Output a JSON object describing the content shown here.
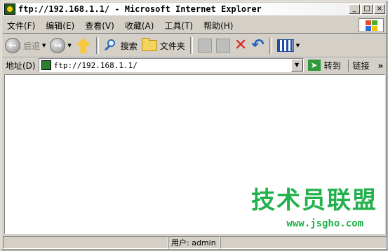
{
  "window": {
    "title": "ftp://192.168.1.1/ - Microsoft Internet Explorer",
    "buttons": {
      "minimize": "_",
      "maximize": "□",
      "close": "×"
    }
  },
  "menu": {
    "items": [
      {
        "label": "文件(F)"
      },
      {
        "label": "编辑(E)"
      },
      {
        "label": "查看(V)"
      },
      {
        "label": "收藏(A)"
      },
      {
        "label": "工具(T)"
      },
      {
        "label": "帮助(H)"
      }
    ]
  },
  "toolbar": {
    "back_label": "后退",
    "search_label": "搜索",
    "folders_label": "文件夹",
    "icons": {
      "back": "back-arrow-icon",
      "forward": "forward-arrow-icon",
      "up": "up-folder-icon",
      "search": "magnifier-icon",
      "folders": "folder-icon",
      "move_to": "move-to-icon",
      "copy_to": "copy-to-icon",
      "delete": "delete-x-icon",
      "undo": "undo-icon",
      "views": "views-icon"
    }
  },
  "address": {
    "label": "地址(D)",
    "value": "ftp://192.168.1.1/",
    "go_label": "转到",
    "links_label": "链接"
  },
  "content": {
    "watermark_text": "技术员联盟",
    "watermark_url": "www.jsgho.com"
  },
  "status": {
    "user_text": "用户: admin"
  },
  "colors": {
    "window_face": "#d4d0c8",
    "watermark": "#22b14c"
  }
}
